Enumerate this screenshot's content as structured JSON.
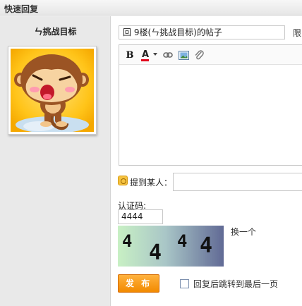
{
  "window": {
    "title": "快速回复"
  },
  "user": {
    "name": "ㄣ挑战目标"
  },
  "form": {
    "subject_value": "回 9楼(ㄣ挑战目标)的帖子",
    "subject_limit_label": "限",
    "mention_label": "提到某人：",
    "captcha_label": "认证码:",
    "captcha_value": "4444",
    "captcha_image_text": "4 4 4 4",
    "refresh_label": "换一个",
    "publish_label": "发 布",
    "jump_label": "回复后跳转到最后一页"
  },
  "toolbar": {
    "bold_label": "B",
    "color_label": "A",
    "items": [
      "bold-icon",
      "font-color-icon",
      "link-icon",
      "image-icon",
      "attachment-icon"
    ]
  },
  "colors": {
    "publish_button": "#f28a00",
    "sidebar_bg": "#e9e9e9",
    "color_bar": "#e2001a"
  }
}
